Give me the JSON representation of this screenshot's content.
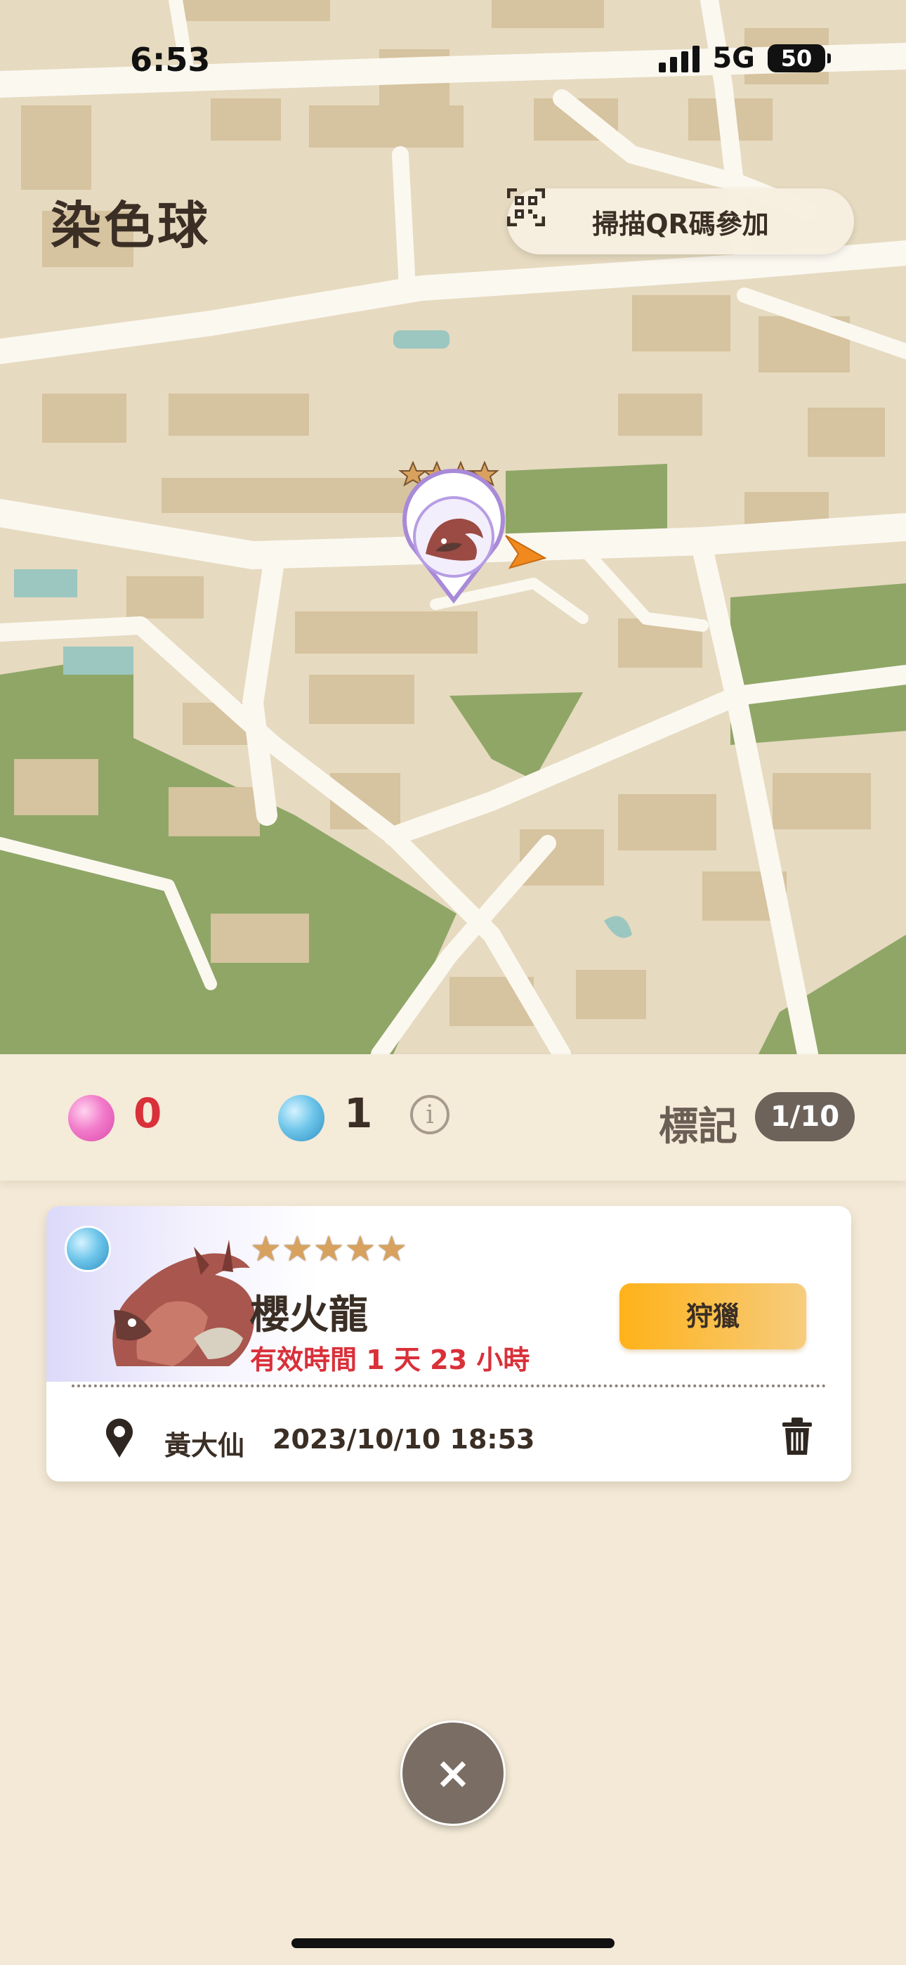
{
  "status_bar": {
    "time": "6:53",
    "network": "5G",
    "battery": "50"
  },
  "header": {
    "title": "染色球",
    "scan_label": "掃描QR碼參加"
  },
  "map": {
    "marker_rarity_stars": 4,
    "marker_icon": "rathalos-monster-icon",
    "player_icon": "orange-arrow-icon"
  },
  "resources": {
    "pink_count": "0",
    "blue_count": "1",
    "info_symbol": "i",
    "mark_label": "標記",
    "mark_count": "1/10"
  },
  "card": {
    "stars": "★★★★★",
    "name": "櫻火龍",
    "valid_time": "有效時間 1 天 23 小時",
    "hunt_label": "狩獵",
    "location": "黃大仙",
    "datetime": "2023/10/10 18:53"
  },
  "close_symbol": "×",
  "colors": {
    "accent_orange": "#ffb219",
    "red_text": "#d9303a",
    "dark_text": "#3a2e25",
    "map_base": "#e6dac0",
    "map_park": "#8fa667"
  }
}
